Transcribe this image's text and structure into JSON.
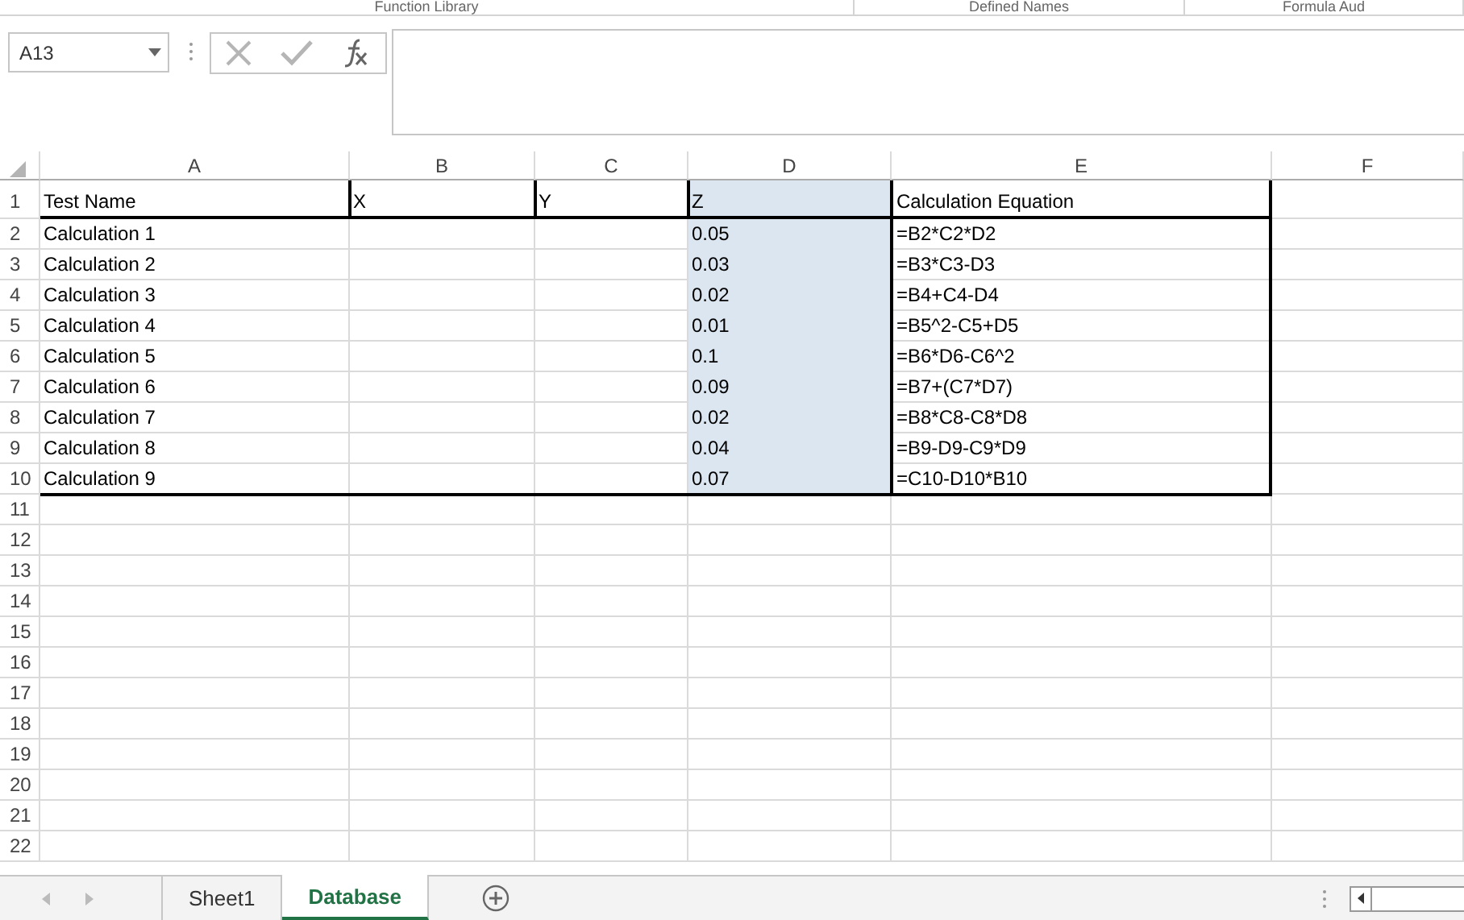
{
  "ribbon_groups": [
    "Function Library",
    "Defined Names",
    "Formula Aud"
  ],
  "name_box": {
    "value": "A13"
  },
  "columns": [
    {
      "label": "A",
      "shaded": false
    },
    {
      "label": "B",
      "shaded": false
    },
    {
      "label": "C",
      "shaded": false
    },
    {
      "label": "D",
      "shaded": true
    },
    {
      "label": "E",
      "shaded": false
    },
    {
      "label": "F",
      "shaded": false
    }
  ],
  "rows": [
    {
      "number": "1",
      "cells": {
        "A": "Test Name",
        "B": "X",
        "C": "Y",
        "D": "Z",
        "E": "Calculation Equation"
      }
    },
    {
      "number": "2",
      "cells": {
        "A": "Calculation 1",
        "D": "0.05",
        "E": "=B2*C2*D2"
      }
    },
    {
      "number": "3",
      "cells": {
        "A": "Calculation 2",
        "D": "0.03",
        "E": "=B3*C3-D3"
      }
    },
    {
      "number": "4",
      "cells": {
        "A": "Calculation 3",
        "D": "0.02",
        "E": "=B4+C4-D4"
      }
    },
    {
      "number": "5",
      "cells": {
        "A": "Calculation 4",
        "D": "0.01",
        "E": "=B5^2-C5+D5"
      }
    },
    {
      "number": "6",
      "cells": {
        "A": "Calculation 5",
        "D": "0.1",
        "E": "=B6*D6-C6^2"
      }
    },
    {
      "number": "7",
      "cells": {
        "A": "Calculation 6",
        "D": "0.09",
        "E": "=B7+(C7*D7)"
      }
    },
    {
      "number": "8",
      "cells": {
        "A": "Calculation 7",
        "D": "0.02",
        "E": "=B8*C8-C8*D8"
      }
    },
    {
      "number": "9",
      "cells": {
        "A": "Calculation 8",
        "D": "0.04",
        "E": "=B9-D9-C9*D9"
      }
    },
    {
      "number": "10",
      "cells": {
        "A": "Calculation 9",
        "D": "0.07",
        "E": "=C10-D10*B10"
      }
    },
    {
      "number": "11"
    },
    {
      "number": "12"
    },
    {
      "number": "13"
    },
    {
      "number": "14"
    },
    {
      "number": "15"
    },
    {
      "number": "16"
    },
    {
      "number": "17"
    },
    {
      "number": "18"
    },
    {
      "number": "19"
    },
    {
      "number": "20"
    },
    {
      "number": "21"
    },
    {
      "number": "22"
    }
  ],
  "sheet_tabs": [
    {
      "label": "Sheet1",
      "selected": false
    },
    {
      "label": "Database",
      "selected": true
    }
  ]
}
